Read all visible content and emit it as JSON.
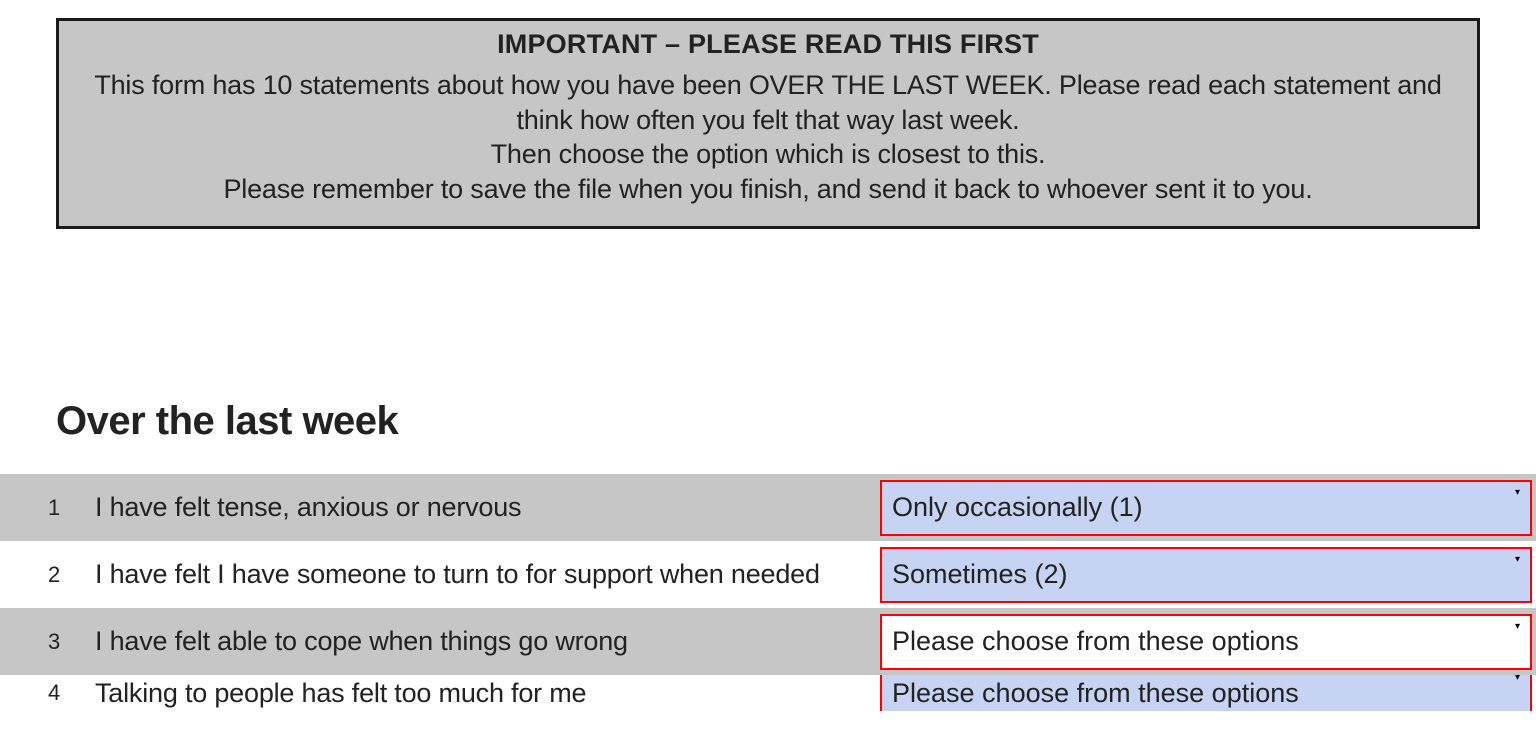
{
  "instructions": {
    "title": "IMPORTANT – PLEASE READ THIS FIRST",
    "line1": "This form has 10 statements about how you have been OVER THE LAST WEEK. Please read each statement and think how often you felt that way last week.",
    "line2": "Then choose the option which is closest to this.",
    "line3": "Please remember to save the file when you finish, and send it back to whoever sent it to you."
  },
  "section_title": "Over the last week",
  "placeholder_text": "Please choose from these options",
  "statements": [
    {
      "num": "1",
      "text": "I have felt tense, anxious or nervous",
      "value": "Only occasionally (1)",
      "filled": true
    },
    {
      "num": "2",
      "text": "I have felt I have someone to turn to for support when needed",
      "value": "Sometimes (2)",
      "filled": true
    },
    {
      "num": "3",
      "text": "I have felt able to cope when things go wrong",
      "value": "Please choose from these options",
      "filled": false
    },
    {
      "num": "4",
      "text": "Talking to people has felt too much for me",
      "value": "Please choose from these options",
      "filled": false
    }
  ]
}
